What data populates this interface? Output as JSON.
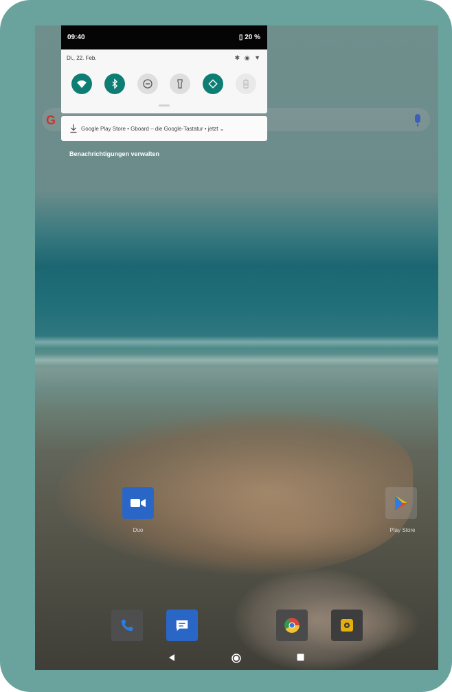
{
  "status_bar": {
    "time": "09:40",
    "battery": "20 %"
  },
  "quick_settings": {
    "date": "Di., 22. Feb.",
    "tiles": [
      {
        "name": "wifi",
        "state": "on",
        "icon": "wifi-icon"
      },
      {
        "name": "bluetooth",
        "state": "on",
        "icon": "bluetooth-icon"
      },
      {
        "name": "do-not-disturb",
        "state": "off",
        "icon": "dnd-icon"
      },
      {
        "name": "flashlight",
        "state": "off",
        "icon": "flashlight-icon"
      },
      {
        "name": "auto-rotate",
        "state": "on",
        "icon": "rotate-icon"
      },
      {
        "name": "battery-saver",
        "state": "disabled",
        "icon": "battery-saver-icon"
      }
    ],
    "accent_color": "#0e7e74"
  },
  "notification": {
    "text": "Google Play Store • Gboard – die Google-Tastatur • jetzt"
  },
  "manage_notifications": "Benachrichtigungen verwalten",
  "home": {
    "apps": [
      {
        "label": "Duo",
        "icon": "duo-video-icon"
      },
      {
        "label": "Play Store",
        "icon": "play-store-icon"
      }
    ],
    "dock": [
      {
        "icon": "phone-icon"
      },
      {
        "icon": "messages-icon"
      },
      {
        "icon": "chrome-icon"
      },
      {
        "icon": "camera-icon"
      }
    ]
  },
  "nav": {
    "back": "back-icon",
    "home": "home-icon",
    "recents": "recents-icon"
  },
  "colors": {
    "tablet_frame": "#6aa39d",
    "blue_app": "#2a66c5"
  }
}
